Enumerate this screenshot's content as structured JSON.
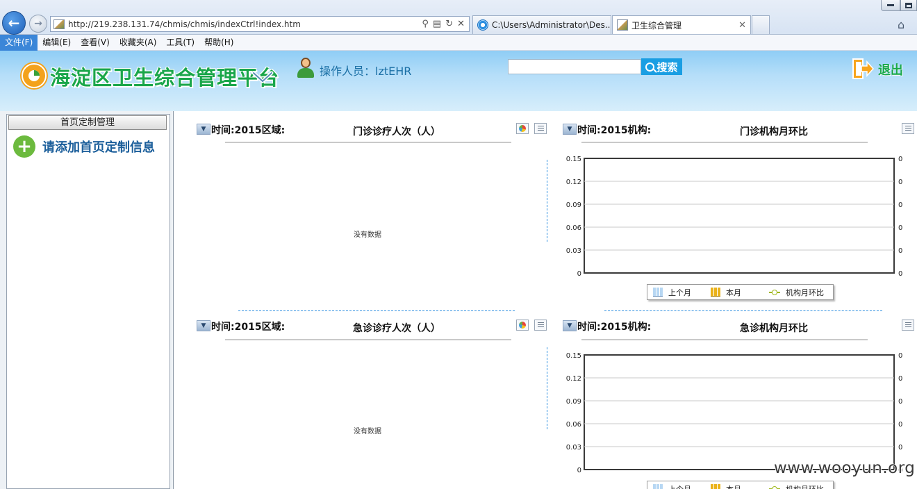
{
  "browser": {
    "url": "http://219.238.131.74/chmis/chmis/indexCtrl!index.htm",
    "tabs": [
      {
        "label": "C:\\Users\\Administrator\\Des...",
        "active": false,
        "icon": "ie-icon"
      },
      {
        "label": "卫生综合管理",
        "active": true,
        "icon": "page-icon"
      }
    ],
    "menu": [
      "文件(F)",
      "编辑(E)",
      "查看(V)",
      "收藏夹(A)",
      "工具(T)",
      "帮助(H)"
    ],
    "active_menu_index": 0
  },
  "header": {
    "app_title": "海淀区卫生综合管理平台",
    "operator_label": "操作人员：lztEHR",
    "search_placeholder": "",
    "search_button": "搜索",
    "logout_label": "退出",
    "colors": {
      "title": "#1aa64a",
      "operator": "#1a6fa5",
      "search_button": "#1a9ee3"
    }
  },
  "sidebar": {
    "header": "首页定制管理",
    "add_label": "请添加首页定制信息"
  },
  "panels": {
    "top_left": {
      "filter_label": "时间:2015区域:",
      "title": "门诊诊疗人次（人）",
      "empty_text": "没有数据"
    },
    "top_right": {
      "filter_label": "时间:2015机构:",
      "title": "门诊机构月环比"
    },
    "bottom_left": {
      "filter_label": "时间:2015区域:",
      "title": "急诊诊疗人次（人）",
      "empty_text": "没有数据"
    },
    "bottom_right": {
      "filter_label": "时间:2015机构:",
      "title": "急诊机构月环比"
    }
  },
  "chart_data": [
    {
      "type": "bar",
      "title": "门诊机构月环比",
      "y_ticks": [
        "0.15",
        "0.12",
        "0.09",
        "0.06",
        "0.03",
        "0"
      ],
      "y2_ticks": [
        "0",
        "0",
        "0",
        "0",
        "0",
        "0"
      ],
      "ylim": [
        0,
        0.15
      ],
      "grid": true,
      "legend_position": "bottom",
      "series": [
        {
          "name": "上个月",
          "type": "bar",
          "values": []
        },
        {
          "name": "本月",
          "type": "bar",
          "values": []
        },
        {
          "name": "机构月环比",
          "type": "line",
          "values": []
        }
      ]
    },
    {
      "type": "bar",
      "title": "急诊机构月环比",
      "y_ticks": [
        "0.15",
        "0.12",
        "0.09",
        "0.06",
        "0.03",
        "0"
      ],
      "y2_ticks": [
        "0",
        "0",
        "0",
        "0",
        "0",
        "0"
      ],
      "ylim": [
        0,
        0.15
      ],
      "grid": true,
      "legend_position": "bottom",
      "series": [
        {
          "name": "上个月",
          "type": "bar",
          "values": []
        },
        {
          "name": "本月",
          "type": "bar",
          "values": []
        },
        {
          "name": "机构月环比",
          "type": "line",
          "values": []
        }
      ]
    }
  ],
  "watermark": "www.wooyun.org"
}
